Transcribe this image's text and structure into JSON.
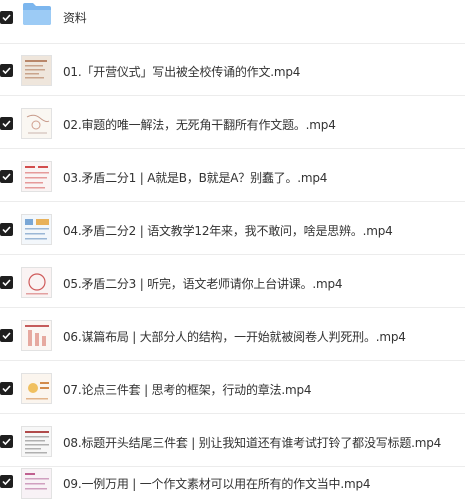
{
  "files": [
    {
      "name": "资料",
      "type": "folder",
      "checked": true,
      "icon": "folder-icon"
    },
    {
      "name": "01.「开营仪式」写出被全校传诵的作文.mp4",
      "type": "video",
      "checked": true
    },
    {
      "name": "02.审题的唯一解法，无死角干翻所有作文题。.mp4",
      "type": "video",
      "checked": true
    },
    {
      "name": "03.矛盾二分1 | A就是B，B就是A？别蠢了。.mp4",
      "type": "video",
      "checked": true
    },
    {
      "name": "04.矛盾二分2 | 语文教学12年来，我不敢问，啥是思辨。.mp4",
      "type": "video",
      "checked": true
    },
    {
      "name": "05.矛盾二分3 | 听完，语文老师请你上台讲课。.mp4",
      "type": "video",
      "checked": true
    },
    {
      "name": "06.谋篇布局 | 大部分人的结构，一开始就被阅卷人判死刑。.mp4",
      "type": "video",
      "checked": true
    },
    {
      "name": "07.论点三件套 | 思考的框架，行动的章法.mp4",
      "type": "video",
      "checked": true
    },
    {
      "name": "08.标题开头结尾三件套 | 别让我知道还有谁考试打铃了都没写标题.mp4",
      "type": "video",
      "checked": true
    },
    {
      "name": "09.一例万用 | 一个作文素材可以用在所有的作文当中.mp4",
      "type": "video",
      "checked": true
    }
  ]
}
